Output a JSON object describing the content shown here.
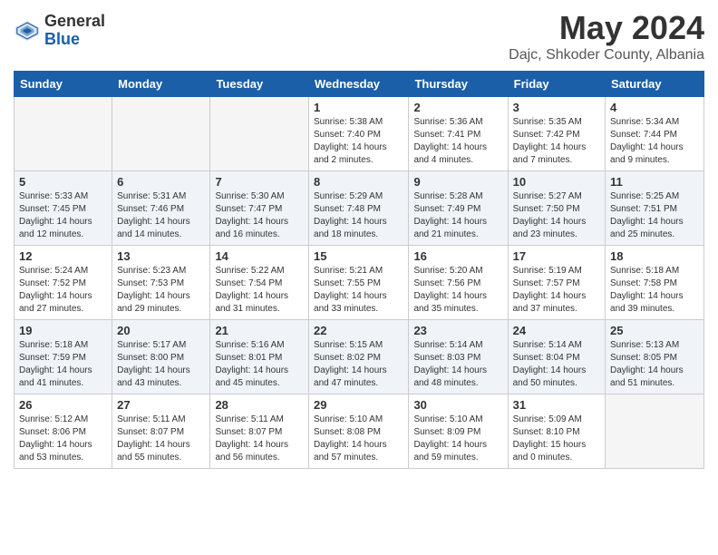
{
  "header": {
    "logo_general": "General",
    "logo_blue": "Blue",
    "title": "May 2024",
    "subtitle": "Dajc, Shkoder County, Albania"
  },
  "days_of_week": [
    "Sunday",
    "Monday",
    "Tuesday",
    "Wednesday",
    "Thursday",
    "Friday",
    "Saturday"
  ],
  "weeks": [
    [
      {
        "day": "",
        "info": ""
      },
      {
        "day": "",
        "info": ""
      },
      {
        "day": "",
        "info": ""
      },
      {
        "day": "1",
        "info": "Sunrise: 5:38 AM\nSunset: 7:40 PM\nDaylight: 14 hours\nand 2 minutes."
      },
      {
        "day": "2",
        "info": "Sunrise: 5:36 AM\nSunset: 7:41 PM\nDaylight: 14 hours\nand 4 minutes."
      },
      {
        "day": "3",
        "info": "Sunrise: 5:35 AM\nSunset: 7:42 PM\nDaylight: 14 hours\nand 7 minutes."
      },
      {
        "day": "4",
        "info": "Sunrise: 5:34 AM\nSunset: 7:44 PM\nDaylight: 14 hours\nand 9 minutes."
      }
    ],
    [
      {
        "day": "5",
        "info": "Sunrise: 5:33 AM\nSunset: 7:45 PM\nDaylight: 14 hours\nand 12 minutes."
      },
      {
        "day": "6",
        "info": "Sunrise: 5:31 AM\nSunset: 7:46 PM\nDaylight: 14 hours\nand 14 minutes."
      },
      {
        "day": "7",
        "info": "Sunrise: 5:30 AM\nSunset: 7:47 PM\nDaylight: 14 hours\nand 16 minutes."
      },
      {
        "day": "8",
        "info": "Sunrise: 5:29 AM\nSunset: 7:48 PM\nDaylight: 14 hours\nand 18 minutes."
      },
      {
        "day": "9",
        "info": "Sunrise: 5:28 AM\nSunset: 7:49 PM\nDaylight: 14 hours\nand 21 minutes."
      },
      {
        "day": "10",
        "info": "Sunrise: 5:27 AM\nSunset: 7:50 PM\nDaylight: 14 hours\nand 23 minutes."
      },
      {
        "day": "11",
        "info": "Sunrise: 5:25 AM\nSunset: 7:51 PM\nDaylight: 14 hours\nand 25 minutes."
      }
    ],
    [
      {
        "day": "12",
        "info": "Sunrise: 5:24 AM\nSunset: 7:52 PM\nDaylight: 14 hours\nand 27 minutes."
      },
      {
        "day": "13",
        "info": "Sunrise: 5:23 AM\nSunset: 7:53 PM\nDaylight: 14 hours\nand 29 minutes."
      },
      {
        "day": "14",
        "info": "Sunrise: 5:22 AM\nSunset: 7:54 PM\nDaylight: 14 hours\nand 31 minutes."
      },
      {
        "day": "15",
        "info": "Sunrise: 5:21 AM\nSunset: 7:55 PM\nDaylight: 14 hours\nand 33 minutes."
      },
      {
        "day": "16",
        "info": "Sunrise: 5:20 AM\nSunset: 7:56 PM\nDaylight: 14 hours\nand 35 minutes."
      },
      {
        "day": "17",
        "info": "Sunrise: 5:19 AM\nSunset: 7:57 PM\nDaylight: 14 hours\nand 37 minutes."
      },
      {
        "day": "18",
        "info": "Sunrise: 5:18 AM\nSunset: 7:58 PM\nDaylight: 14 hours\nand 39 minutes."
      }
    ],
    [
      {
        "day": "19",
        "info": "Sunrise: 5:18 AM\nSunset: 7:59 PM\nDaylight: 14 hours\nand 41 minutes."
      },
      {
        "day": "20",
        "info": "Sunrise: 5:17 AM\nSunset: 8:00 PM\nDaylight: 14 hours\nand 43 minutes."
      },
      {
        "day": "21",
        "info": "Sunrise: 5:16 AM\nSunset: 8:01 PM\nDaylight: 14 hours\nand 45 minutes."
      },
      {
        "day": "22",
        "info": "Sunrise: 5:15 AM\nSunset: 8:02 PM\nDaylight: 14 hours\nand 47 minutes."
      },
      {
        "day": "23",
        "info": "Sunrise: 5:14 AM\nSunset: 8:03 PM\nDaylight: 14 hours\nand 48 minutes."
      },
      {
        "day": "24",
        "info": "Sunrise: 5:14 AM\nSunset: 8:04 PM\nDaylight: 14 hours\nand 50 minutes."
      },
      {
        "day": "25",
        "info": "Sunrise: 5:13 AM\nSunset: 8:05 PM\nDaylight: 14 hours\nand 51 minutes."
      }
    ],
    [
      {
        "day": "26",
        "info": "Sunrise: 5:12 AM\nSunset: 8:06 PM\nDaylight: 14 hours\nand 53 minutes."
      },
      {
        "day": "27",
        "info": "Sunrise: 5:11 AM\nSunset: 8:07 PM\nDaylight: 14 hours\nand 55 minutes."
      },
      {
        "day": "28",
        "info": "Sunrise: 5:11 AM\nSunset: 8:07 PM\nDaylight: 14 hours\nand 56 minutes."
      },
      {
        "day": "29",
        "info": "Sunrise: 5:10 AM\nSunset: 8:08 PM\nDaylight: 14 hours\nand 57 minutes."
      },
      {
        "day": "30",
        "info": "Sunrise: 5:10 AM\nSunset: 8:09 PM\nDaylight: 14 hours\nand 59 minutes."
      },
      {
        "day": "31",
        "info": "Sunrise: 5:09 AM\nSunset: 8:10 PM\nDaylight: 15 hours\nand 0 minutes."
      },
      {
        "day": "",
        "info": ""
      }
    ]
  ]
}
